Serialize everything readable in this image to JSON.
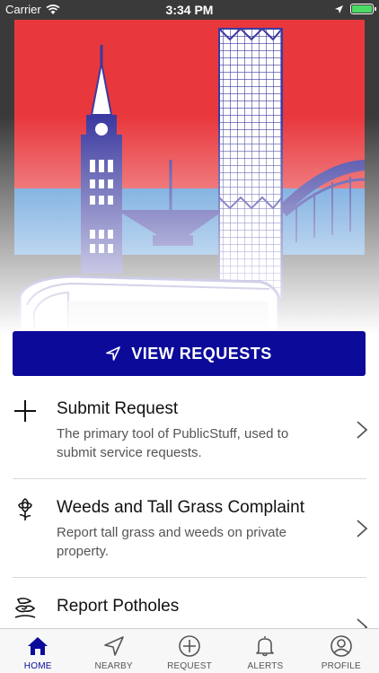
{
  "status_bar": {
    "carrier": "Carrier",
    "time": "3:34 PM"
  },
  "colors": {
    "brand": "#0c0a99",
    "sky_red": "#e8383d",
    "water_blue": "#4a8fd4",
    "text_secondary": "#555555"
  },
  "primary_action": {
    "label": "VIEW REQUESTS",
    "icon": "location-arrow-icon"
  },
  "services": [
    {
      "icon": "plus-icon",
      "title": "Submit Request",
      "description": "The primary tool of PublicStuff, used to submit service requests."
    },
    {
      "icon": "flower-icon",
      "title": "Weeds and Tall Grass Complaint",
      "description": "Report tall grass and weeds on private property."
    },
    {
      "icon": "pothole-icon",
      "title": "Report Potholes",
      "description": ""
    }
  ],
  "tabs": [
    {
      "label": "HOME",
      "icon": "home-icon",
      "active": true
    },
    {
      "label": "NEARBY",
      "icon": "location-arrow-icon",
      "active": false
    },
    {
      "label": "REQUEST",
      "icon": "plus-circle-icon",
      "active": false
    },
    {
      "label": "ALERTS",
      "icon": "bell-icon",
      "active": false
    },
    {
      "label": "PROFILE",
      "icon": "person-circle-icon",
      "active": false
    }
  ]
}
